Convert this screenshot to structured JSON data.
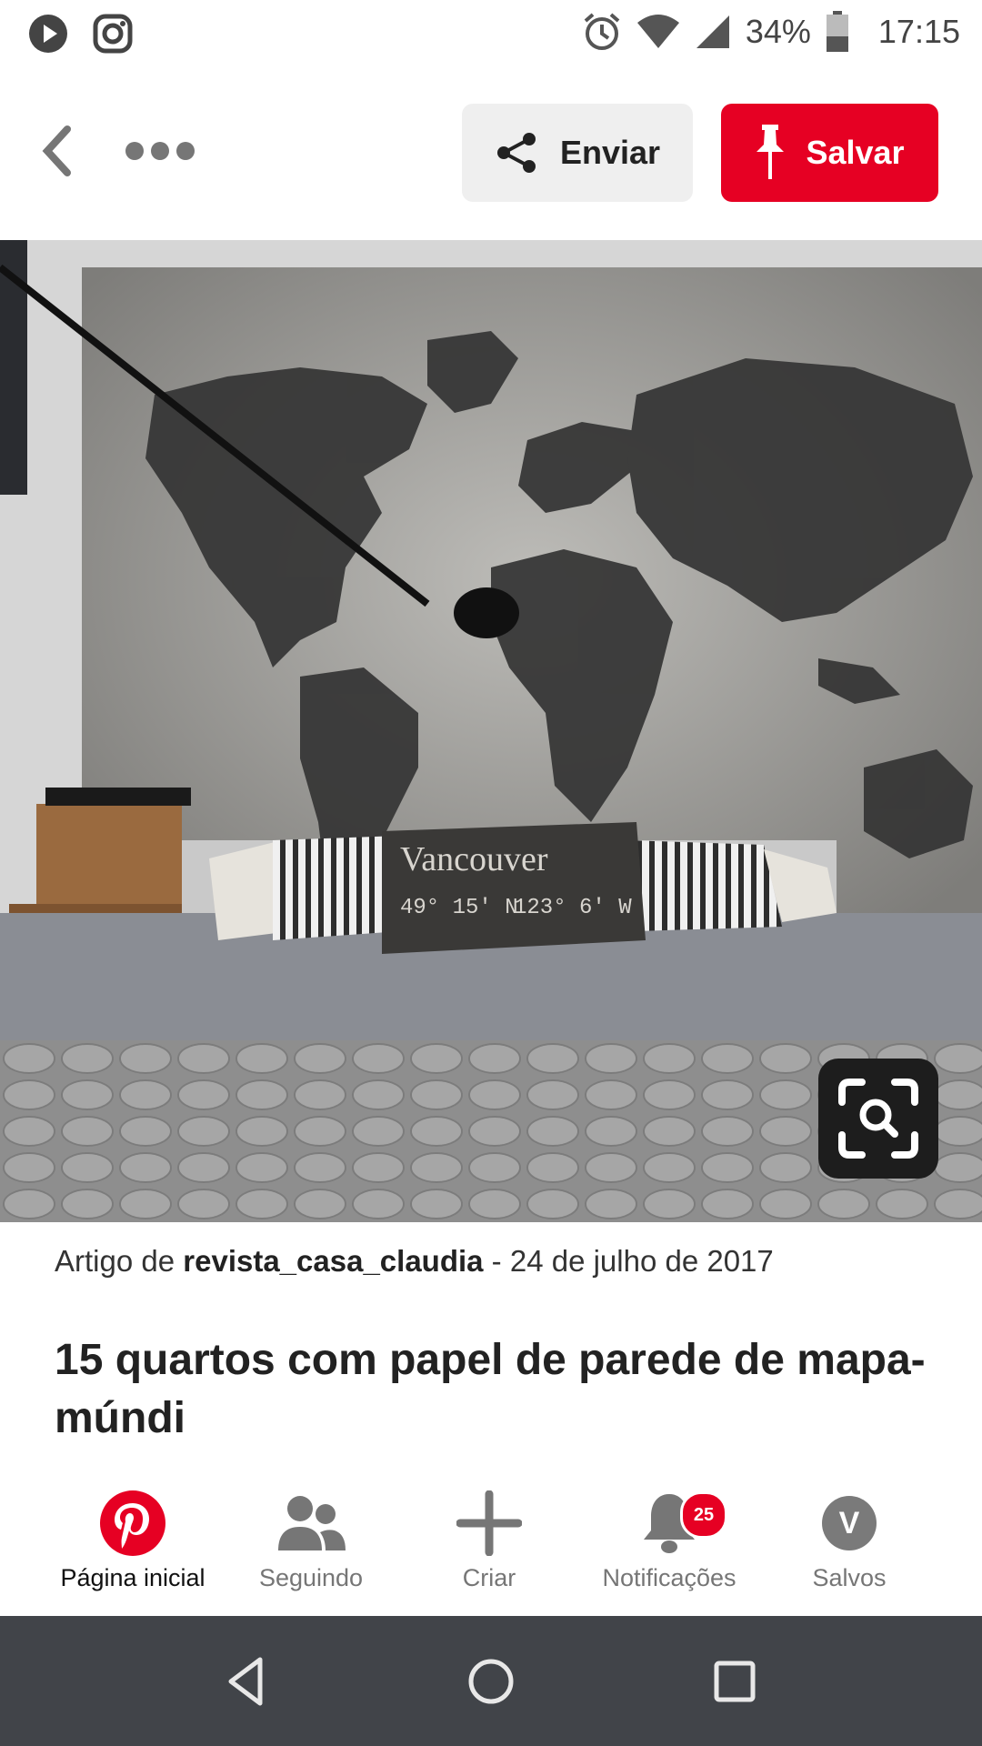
{
  "status_bar": {
    "battery": "34%",
    "time": "17:15",
    "icons": [
      "play-icon",
      "instagram-icon",
      "alarm-icon",
      "wifi-icon",
      "signal-icon",
      "battery-icon"
    ]
  },
  "toolbar": {
    "send_label": "Enviar",
    "save_label": "Salvar",
    "icons": [
      "back-icon",
      "more-icon",
      "share-icon",
      "pin-icon"
    ]
  },
  "pin": {
    "pillow_line1": "Vancouver",
    "pillow_line2": "49° 15′ N",
    "pillow_line3": "123° 6′ W",
    "meta_prefix": "Artigo de",
    "author": "revista_casa_claudia",
    "date": " - 24 de julho de 2017",
    "title": "15 quartos com papel de parede de mapa-múndi"
  },
  "bottom_nav": {
    "items": [
      {
        "label": "Página inicial",
        "icon": "pinterest-icon"
      },
      {
        "label": "Seguindo",
        "icon": "people-icon"
      },
      {
        "label": "Criar",
        "icon": "plus-icon"
      },
      {
        "label": "Notificações",
        "icon": "bell-icon"
      },
      {
        "label": "Salvos",
        "icon": "avatar"
      }
    ],
    "notifications_badge": "25",
    "avatar_letter": "V"
  },
  "colors": {
    "brand_red": "#e60023",
    "android_nav": "#414449"
  }
}
